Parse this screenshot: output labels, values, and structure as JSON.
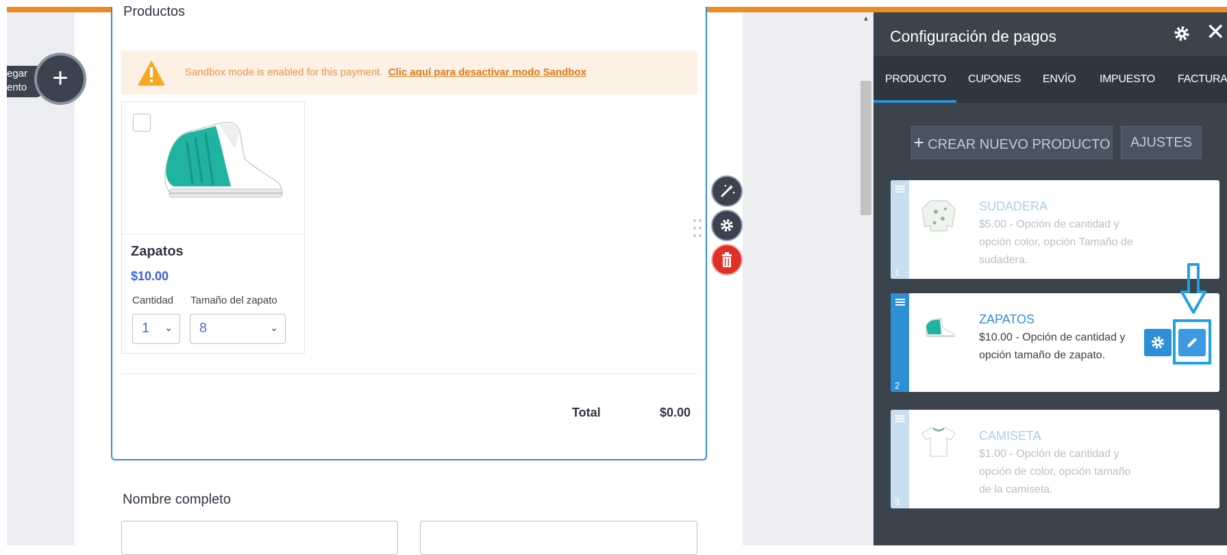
{
  "add_element": {
    "label_line1": "egar",
    "label_line2": "ento",
    "plus": "+"
  },
  "products_widget": {
    "heading": "Productos",
    "sandbox_notice": "Sandbox mode is enabled for this payment.",
    "sandbox_link": "Clic aquí para desactivar modo Sandbox",
    "product": {
      "name": "Zapatos",
      "price": "$10.00",
      "quantity_label": "Cantidad",
      "quantity_value": "1",
      "size_label": "Tamaño del zapato",
      "size_value": "8"
    },
    "total_label": "Total",
    "total_value": "$0.00"
  },
  "form": {
    "full_name_label": "Nombre completo"
  },
  "panel": {
    "title": "Configuración de pagos",
    "tabs": [
      "PRODUCTO",
      "CUPONES",
      "ENVÍO",
      "IMPUESTO",
      "FACTURA"
    ],
    "active_tab": "PRODUCTO",
    "create_button": "CREAR NUEVO PRODUCTO",
    "create_button_icon": "+",
    "settings_button": "AJUSTES",
    "products": [
      {
        "number": "1",
        "name": "SUDADERA",
        "description": "$5.00 - Opción de cantidad y opción color, opción Tamaño de sudadera.",
        "thumbnail_icon": "sweatshirt-icon"
      },
      {
        "number": "2",
        "name": "ZAPATOS",
        "description": "$10.00 - Opción de cantidad y opción tamaño de zapato.",
        "thumbnail_icon": "shoe-icon"
      },
      {
        "number": "3",
        "name": "CAMISETA",
        "description": "$1.00 - Opción de cantidad y opción de color, opción tamaño de la camiseta.",
        "thumbnail_icon": "tshirt-icon"
      }
    ]
  },
  "colors": {
    "accent": "#2d8fd6",
    "panel_bg": "#3b434d",
    "progress": "#f08a24",
    "danger": "#e02f26",
    "price_blue": "#3a5fe5",
    "highlight": "#1fa1e8"
  }
}
